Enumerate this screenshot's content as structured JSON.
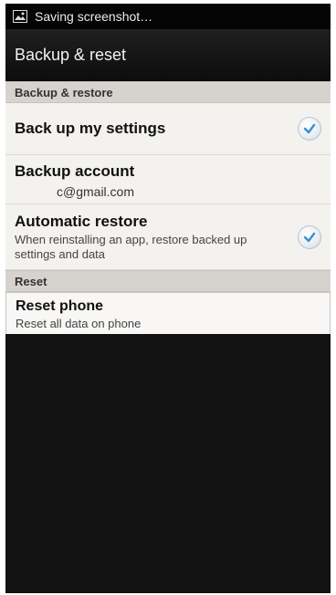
{
  "status_bar": {
    "notification_icon": "image-icon",
    "text": "Saving screenshot…"
  },
  "header": {
    "title": "Backup & reset"
  },
  "sections": {
    "backup_restore": {
      "header": "Backup & restore",
      "back_up_settings": {
        "title": "Back up my settings",
        "checked": true
      },
      "backup_account": {
        "title": "Backup account",
        "value": "c@gmail.com"
      },
      "automatic_restore": {
        "title": "Automatic restore",
        "description": "When reinstalling an app, restore backed up settings and data",
        "checked": true
      }
    },
    "reset": {
      "header": "Reset",
      "reset_phone": {
        "title": "Reset phone",
        "description": "Reset all data on phone"
      }
    }
  },
  "colors": {
    "check_accent": "#3a8fd6",
    "background_dark": "#111111",
    "list_background": "#f4f2ef",
    "section_header": "#d6d3cf"
  }
}
